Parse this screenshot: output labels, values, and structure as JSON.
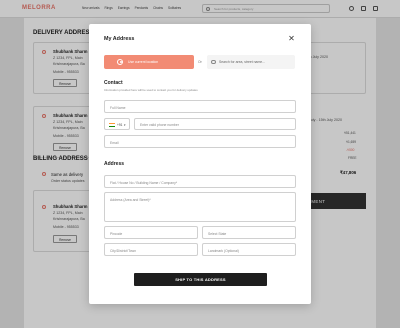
{
  "header": {
    "logo": "MELORRA",
    "nav": [
      "New arrivals",
      "Rings",
      "Earrings",
      "Pendants",
      "Chains",
      "Solitaires"
    ],
    "search_placeholder": "Search for products, category"
  },
  "background": {
    "delivery_title": "DELIVERY ADDRESS",
    "billing_title": "BILLING ADDRESS",
    "cards": [
      {
        "name": "Shubhank Sharm",
        "line1": "Z 1234, FPL, Main",
        "line2": "Krishnarajapura, Ba",
        "mobile": "Mobile - 955533",
        "delivery": "7th July - 15th July 2020"
      },
      {
        "name": "Shubhank Sharm",
        "line1": "Z 1234, FPL, Main",
        "line2": "Krishnarajapura, Ba",
        "mobile": "Mobile - 955533",
        "delivery": "7th July - 15th July 2020"
      }
    ],
    "remove_label": "Remove",
    "same_as_delivery": "Same as delivery",
    "same_sub": "Order status updates",
    "billing_card": {
      "name": "Shubhank Sharm",
      "line1": "Z 1234, FPL, Main",
      "line2": "Krishnarajapura, Ba",
      "mobile": "Mobile - 955533"
    },
    "prices": [
      "₹51,441",
      "₹1,659",
      "-₹500",
      "FREE"
    ],
    "total": "₹47,806",
    "pay_label": "YMENT"
  },
  "modal": {
    "title": "My Address",
    "close_icon": "close-icon",
    "use_location": "Use current location",
    "or": "Or",
    "area_search_placeholder": "Search for area, street name...",
    "contact_heading": "Contact",
    "contact_hint": "Information provided here will be used to contact you for delivery updates",
    "full_name": "Full Name",
    "country_code": "+91",
    "phone_placeholder": "Enter valid phone number",
    "email": "Email",
    "address_heading": "Address",
    "flat": "Flat / House No / Building Name / Company*",
    "address_area": "Address (Area and Street)*",
    "pincode": "Pincode",
    "state": "Select State",
    "city": "City/District/Town",
    "landmark": "Landmark (Optional)",
    "submit": "SHIP TO THIS ADDRESS"
  },
  "colors": {
    "accent": "#f28b74",
    "button_dark": "#1e1e1e"
  }
}
